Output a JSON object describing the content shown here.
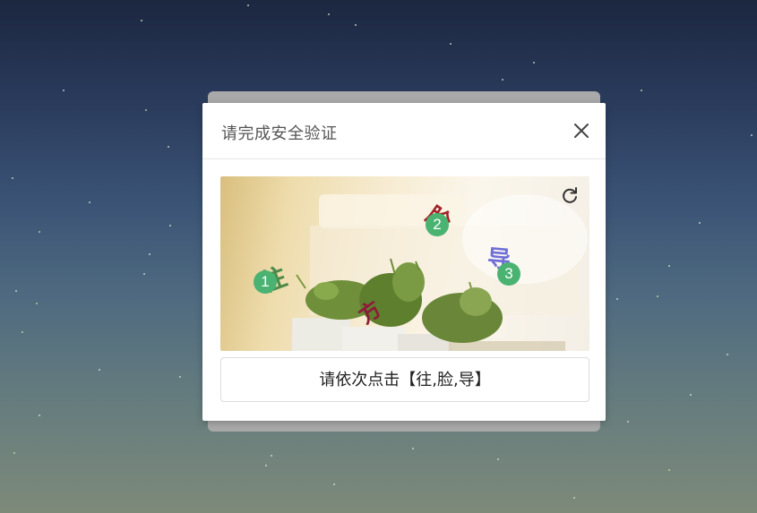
{
  "dialog": {
    "title": "请完成安全验证",
    "close_icon": "close-icon",
    "refresh_icon": "refresh-icon"
  },
  "captcha": {
    "characters": [
      {
        "text": "往",
        "color": "#4d8a4a"
      },
      {
        "text": "脸",
        "color": "#a3222a"
      },
      {
        "text": "导",
        "color": "#6f6fd8"
      },
      {
        "text": "方",
        "color": "#8e1a3a"
      }
    ],
    "markers": [
      "1",
      "2",
      "3"
    ],
    "instruction": "请依次点击【往,脸,导】"
  },
  "colors": {
    "marker": "#4bb372",
    "dialog_bg": "#ffffff"
  }
}
